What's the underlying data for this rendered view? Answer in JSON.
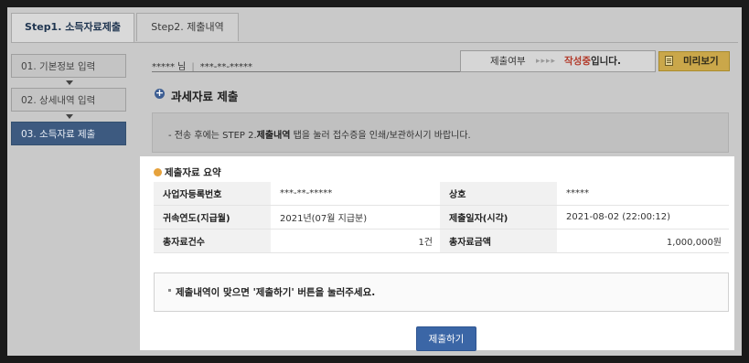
{
  "tabs": [
    {
      "label": "Step1. 소득자료제출",
      "active": true
    },
    {
      "label": "Step2. 제출내역",
      "active": false
    }
  ],
  "sidebar": {
    "items": [
      {
        "label": "01. 기본정보 입력",
        "active": false
      },
      {
        "label": "02. 상세내역 입력",
        "active": false
      },
      {
        "label": "03. 소득자료 제출",
        "active": true
      }
    ]
  },
  "user": {
    "name": "***** 님",
    "id": "***-**-*****"
  },
  "status": {
    "label": "제출여부",
    "arrows": "▸▸▸▸",
    "value_highlight": "작성중",
    "value_suffix": "입니다."
  },
  "preview_button": {
    "label": "미리보기",
    "icon": "document-icon"
  },
  "section": {
    "title": "과세자료 제출",
    "icon": "plus-circle-icon"
  },
  "notice": {
    "prefix": "- 전송 후에는 STEP 2.",
    "bold": "제출내역",
    "suffix": " 탭을 눌러 접수증을 인쇄/보관하시기 바랍니다."
  },
  "summary": {
    "title": "제출자료 요약",
    "rows": [
      [
        {
          "label": "사업자등록번호",
          "value": "***-**-*****"
        },
        {
          "label": "상호",
          "value": "*****"
        }
      ],
      [
        {
          "label": "귀속연도(지급월)",
          "value": "2021년(07월 지급분)"
        },
        {
          "label": "제출일자(시각)",
          "value": "2021-08-02 (22:00:12)"
        }
      ],
      [
        {
          "label": "총자료건수",
          "value": "1건"
        },
        {
          "label": "총자료금액",
          "value": "1,000,000원"
        }
      ]
    ]
  },
  "message": "제출내역이 맞으면 '제출하기' 버튼을 눌러주세요.",
  "submit_button": {
    "label": "제출하기"
  },
  "colors": {
    "accent": "#3b66a6",
    "status_highlight": "#b23a2a",
    "preview": "#caa74a"
  }
}
